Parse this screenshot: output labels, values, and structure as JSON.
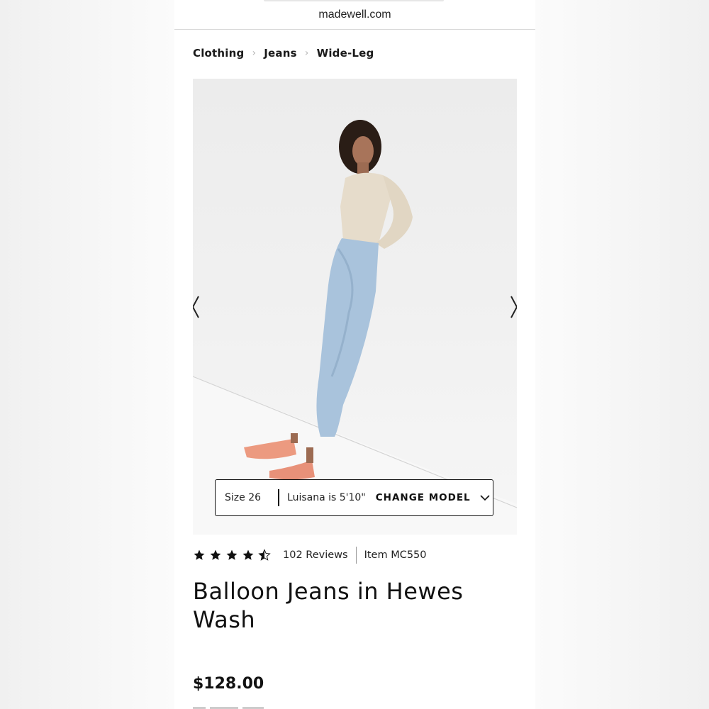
{
  "browser": {
    "url": "madewell.com"
  },
  "breadcrumb": {
    "items": [
      "Clothing",
      "Jeans",
      "Wide-Leg"
    ]
  },
  "gallery": {
    "image_alt": "Model wearing Balloon Jeans in Hewes Wash",
    "size_label": "Size 26",
    "model_label": "Luisana is 5'10\"",
    "change_model_label": "CHANGE MODEL"
  },
  "product": {
    "rating": 4.5,
    "reviews_label": "102 Reviews",
    "item_label": "Item MC550",
    "title": "Balloon Jeans in Hewes Wash",
    "price": "$128.00"
  },
  "colors": {
    "text": "#111111",
    "background": "#ffffff",
    "photo_bg": "#eeeeee"
  },
  "icons": {
    "prev": "chevron-left-icon",
    "next": "chevron-right-icon",
    "dropdown": "chevron-down-icon",
    "star": "star-icon"
  }
}
